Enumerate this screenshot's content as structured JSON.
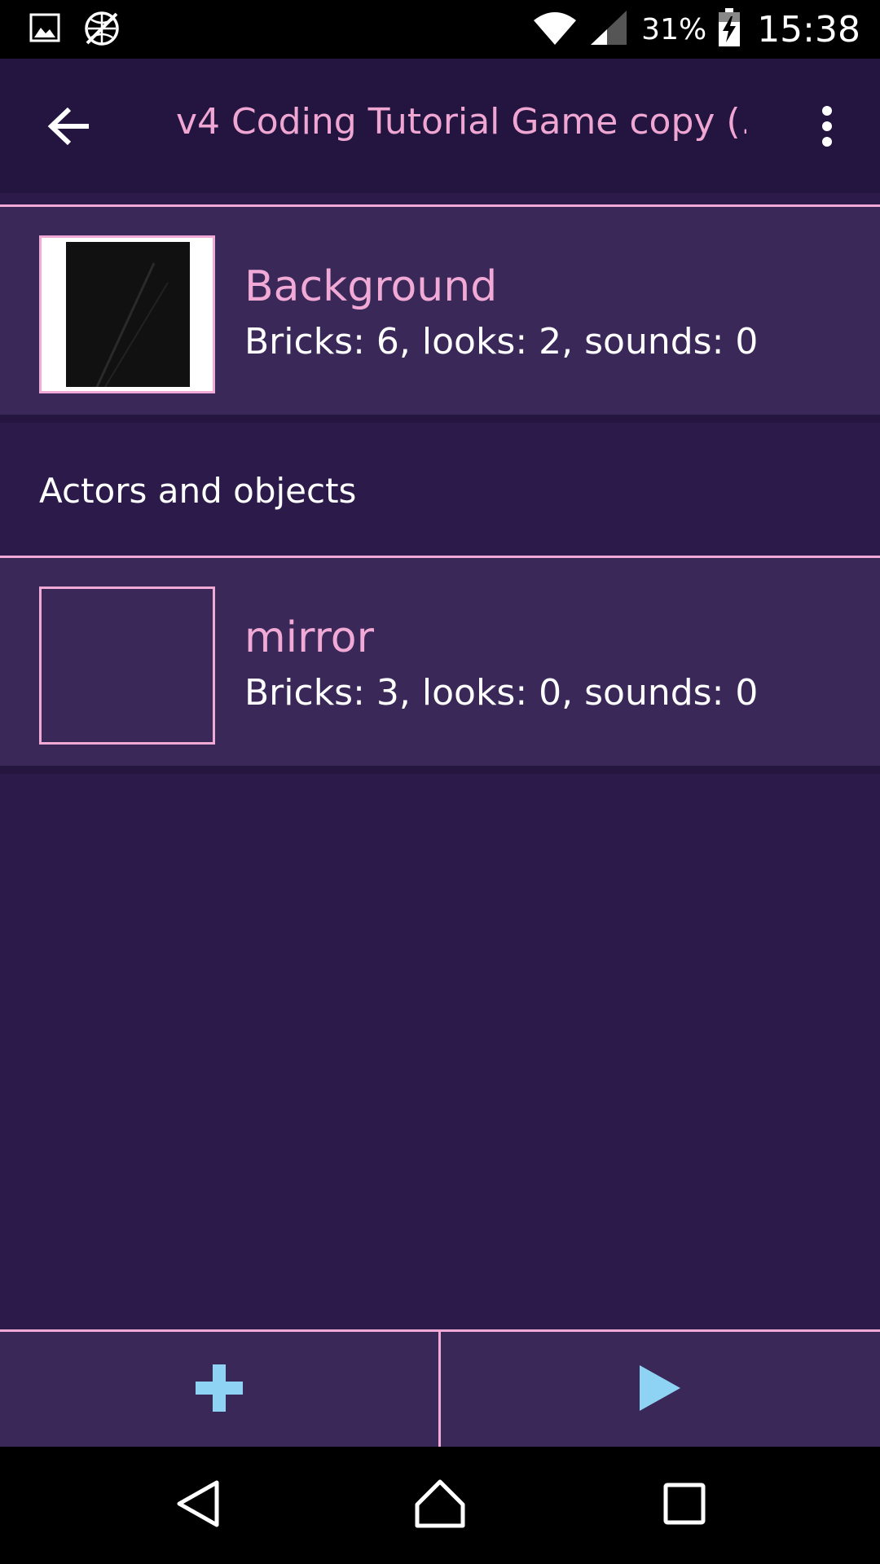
{
  "status_bar": {
    "battery_text": "31%",
    "time": "15:38",
    "icons": [
      "image-icon",
      "no-data-icon",
      "wifi-icon",
      "signal-icon",
      "battery-charging-icon"
    ]
  },
  "app_bar": {
    "title": "v4 Coding Tutorial Game copy (…",
    "back_icon": "arrow-back-icon",
    "menu_icon": "more-vert-icon"
  },
  "background_item": {
    "name": "Background",
    "details": "Bricks: 6, looks: 2, sounds: 0"
  },
  "section": {
    "title": "Actors and objects"
  },
  "objects": [
    {
      "name": "mirror",
      "details": "Bricks: 3, looks: 0, sounds: 0"
    }
  ],
  "bottom_bar": {
    "add_icon": "plus-icon",
    "play_icon": "play-icon",
    "accent_color": "#8fd3f4"
  },
  "nav_bar": {
    "icons": [
      "back-triangle-icon",
      "home-icon",
      "recents-icon"
    ]
  },
  "colors": {
    "background": "#2b1a4a",
    "app_bar": "#23153f",
    "item": "#3a2858",
    "accent_pink": "#f1a9d6"
  }
}
